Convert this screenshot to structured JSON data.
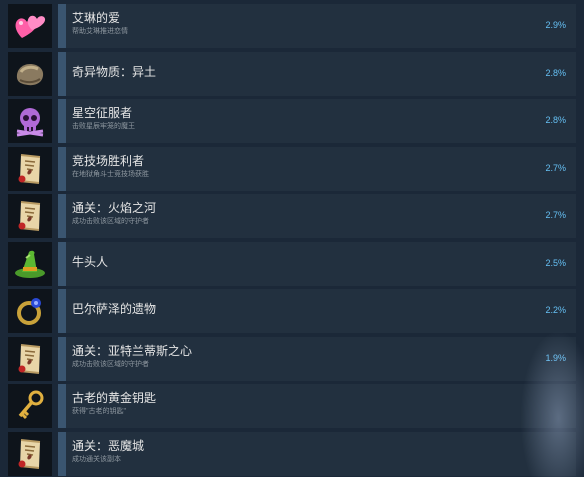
{
  "achievements": [
    {
      "title": "艾琳的爱",
      "desc": "帮助艾琳推进恋情",
      "percent": "2.9%",
      "fill": 0.029,
      "icon": "hearts-icon"
    },
    {
      "title": "奇异物质：异土",
      "desc": "",
      "percent": "2.8%",
      "fill": 0.028,
      "icon": "rock-icon"
    },
    {
      "title": "星空征服者",
      "desc": "击败星辰牢笼的魔王",
      "percent": "2.8%",
      "fill": 0.028,
      "icon": "skull-icon"
    },
    {
      "title": "竞技场胜利者",
      "desc": "在地狱角斗士竞技场获胜",
      "percent": "2.7%",
      "fill": 0.027,
      "icon": "scroll-icon"
    },
    {
      "title": "通关：火焰之河",
      "desc": "成功击败该区域的守护者",
      "percent": "2.7%",
      "fill": 0.027,
      "icon": "scroll-icon"
    },
    {
      "title": "牛头人",
      "desc": "",
      "percent": "2.5%",
      "fill": 0.025,
      "icon": "witch-hat-icon"
    },
    {
      "title": "巴尔萨泽的遗物",
      "desc": "",
      "percent": "2.2%",
      "fill": 0.022,
      "icon": "ring-icon"
    },
    {
      "title": "通关：亚特兰蒂斯之心",
      "desc": "成功击败该区域的守护者",
      "percent": "1.9%",
      "fill": 0.019,
      "icon": "scroll-icon"
    },
    {
      "title": "古老的黄金钥匙",
      "desc": "获得\"古老的钥匙\"",
      "percent": "",
      "fill": 0.018,
      "icon": "key-icon"
    },
    {
      "title": "通关：恶魔城",
      "desc": "成功通关该副本",
      "percent": "",
      "fill": 0.017,
      "icon": "scroll-icon"
    }
  ],
  "colors": {
    "background": "#1b2838",
    "row": "#22303f",
    "accent": "#66c0f4"
  }
}
